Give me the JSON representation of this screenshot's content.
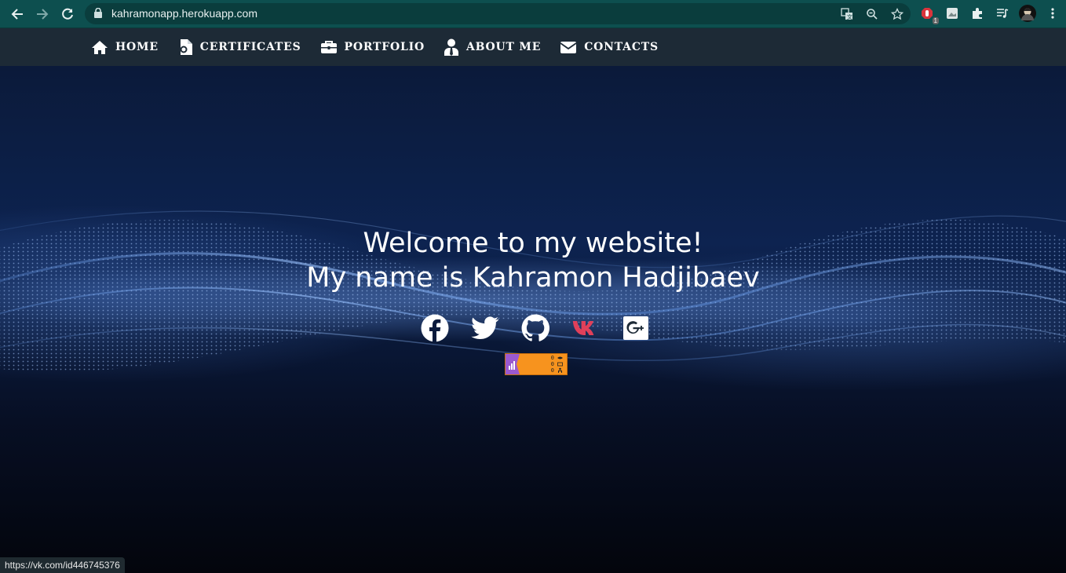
{
  "browser": {
    "url": "kahramonapp.herokuapp.com",
    "extension_badge": "1"
  },
  "nav": {
    "items": [
      {
        "label": "HOME",
        "icon": "home-icon"
      },
      {
        "label": "CERTIFICATES",
        "icon": "certificate-icon"
      },
      {
        "label": "PORTFOLIO",
        "icon": "briefcase-icon"
      },
      {
        "label": "ABOUT ME",
        "icon": "user-tie-icon"
      },
      {
        "label": "CONTACTS",
        "icon": "envelope-icon"
      }
    ]
  },
  "hero": {
    "line1": "Welcome to my website!",
    "line2": "My name is Kahramon Hadjibaev"
  },
  "socials": [
    {
      "name": "facebook-icon",
      "color": "#ffffff"
    },
    {
      "name": "twitter-icon",
      "color": "#ffffff"
    },
    {
      "name": "github-icon",
      "color": "#ffffff"
    },
    {
      "name": "vk-icon",
      "color": "#e0405a"
    },
    {
      "name": "google-plus-icon",
      "color": "#ffffff"
    }
  ],
  "counter": {
    "row1": "0",
    "row2": "0",
    "row3": "0"
  },
  "status_bar": {
    "text": "https://vk.com/id446745376"
  }
}
